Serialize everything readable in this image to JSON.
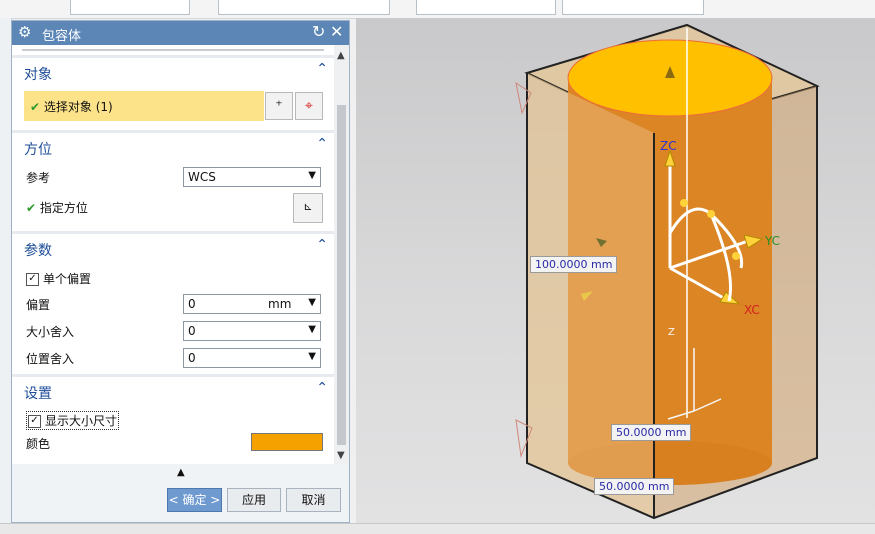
{
  "dialog": {
    "title": "包容体",
    "sections": {
      "object": {
        "header": "对象",
        "select_label": "选择对象 (1)"
      },
      "orientation": {
        "header": "方位",
        "ref_label": "参考",
        "ref_value": "WCS",
        "specify_label": "指定方位"
      },
      "params": {
        "header": "参数",
        "single_offset_label": "单个偏置",
        "offset_label": "偏置",
        "offset_value": "0",
        "offset_unit": "mm",
        "size_round_label": "大小舍入",
        "size_round_value": "0",
        "pos_round_label": "位置舍入",
        "pos_round_value": "0"
      },
      "settings": {
        "header": "设置",
        "show_size_label": "显示大小尺寸",
        "color_label": "颜色",
        "color_value": "#f5a100"
      }
    },
    "buttons": {
      "ok": "< 确定 >",
      "apply": "应用",
      "cancel": "取消"
    }
  },
  "viewport": {
    "axis_labels": {
      "zc": "ZC",
      "yc": "YC",
      "xc": "XC",
      "z": "Z"
    },
    "dimensions": {
      "height": "100.0000 mm",
      "width": "50.0000 mm",
      "depth": "50.0000 mm"
    },
    "colors": {
      "cylinder": "#e08a20",
      "cylinder_top": "#ffc000",
      "box_edges": "#222222",
      "axis_zc": "#3333cc",
      "axis_yc": "#2a8f2a",
      "axis_xc": "#d42020"
    }
  },
  "icons": [
    "gear-icon",
    "reset-icon",
    "close-icon",
    "collapse-icon",
    "checkmark-icon",
    "add-object-icon",
    "crosshair-icon",
    "csys-icon",
    "dropdown-arrow-icon",
    "scroll-up-icon",
    "scroll-down-icon"
  ]
}
